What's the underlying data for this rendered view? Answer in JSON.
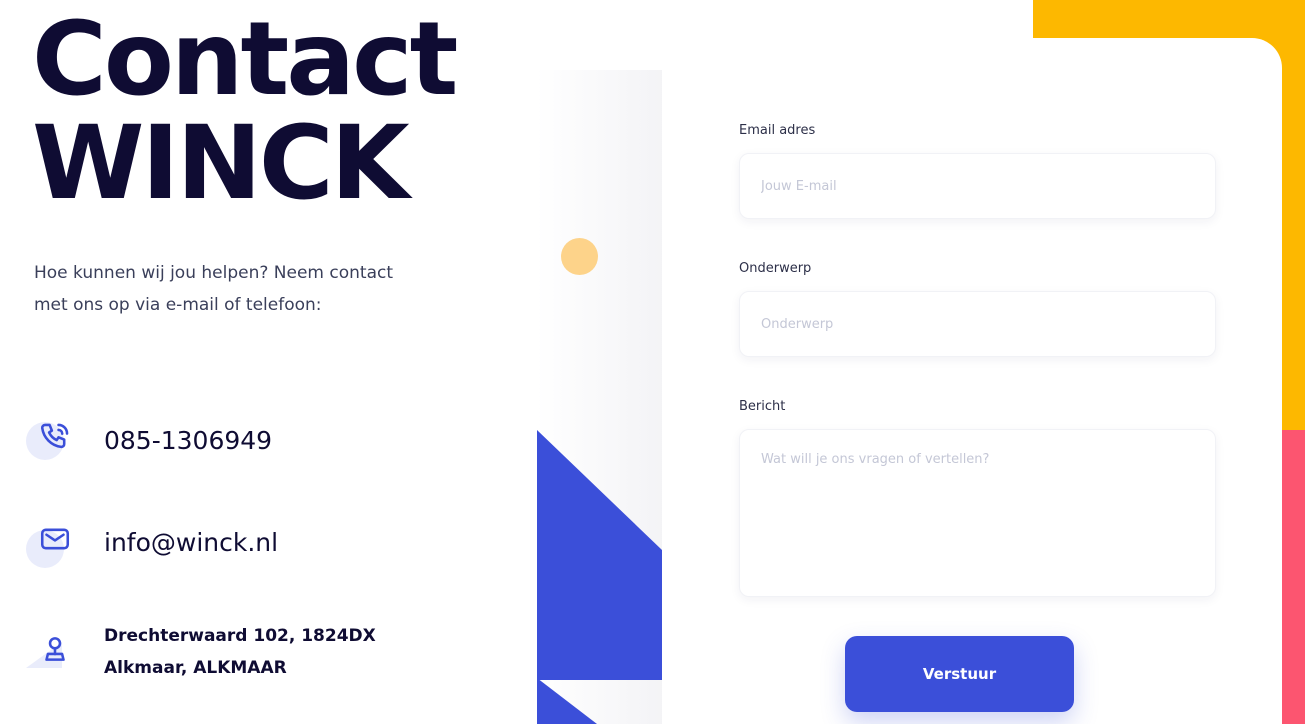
{
  "header": {
    "title_line1": "Contact",
    "title_line2": "WINCK"
  },
  "intro": {
    "line1": "Hoe kunnen wij jou helpen? Neem contact",
    "line2": "met ons op via e-mail of telefoon:"
  },
  "contact": {
    "phone": "085-1306949",
    "email": "info@winck.nl",
    "address_line1": "Drechterwaard 102, 1824DX",
    "address_line2": "Alkmaar, ALKMAAR"
  },
  "form": {
    "email": {
      "label": "Email adres",
      "placeholder": "Jouw E-mail",
      "value": ""
    },
    "subject": {
      "label": "Onderwerp",
      "placeholder": "Onderwerp",
      "value": ""
    },
    "message": {
      "label": "Bericht",
      "placeholder": "Wat will je ons vragen of vertellen?",
      "value": ""
    },
    "submit_label": "Verstuur"
  },
  "icons": {
    "phone": "phone-icon",
    "email": "envelope-icon",
    "address": "map-pin-icon"
  },
  "colors": {
    "primary": "#3b4fd9",
    "dark_text": "#0f0c33",
    "accent_yellow": "#fdb800",
    "accent_pink": "#fc5570",
    "soft_yellow": "#fdd38a"
  }
}
